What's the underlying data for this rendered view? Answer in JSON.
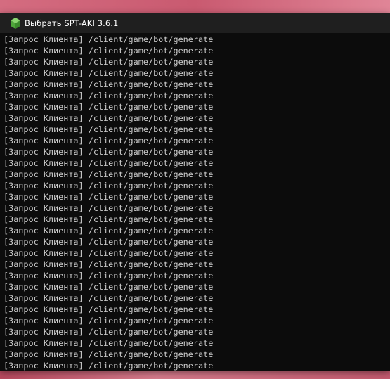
{
  "window": {
    "title": "Выбрать SPT-AKI 3.6.1",
    "icon": "green-cube-icon"
  },
  "console": {
    "lines": [
      "[Запрос Клиента] /client/game/bot/generate",
      "[Запрос Клиента] /client/game/bot/generate",
      "[Запрос Клиента] /client/game/bot/generate",
      "[Запрос Клиента] /client/game/bot/generate",
      "[Запрос Клиента] /client/game/bot/generate",
      "[Запрос Клиента] /client/game/bot/generate",
      "[Запрос Клиента] /client/game/bot/generate",
      "[Запрос Клиента] /client/game/bot/generate",
      "[Запрос Клиента] /client/game/bot/generate",
      "[Запрос Клиента] /client/game/bot/generate",
      "[Запрос Клиента] /client/game/bot/generate",
      "[Запрос Клиента] /client/game/bot/generate",
      "[Запрос Клиента] /client/game/bot/generate",
      "[Запрос Клиента] /client/game/bot/generate",
      "[Запрос Клиента] /client/game/bot/generate",
      "[Запрос Клиента] /client/game/bot/generate",
      "[Запрос Клиента] /client/game/bot/generate",
      "[Запрос Клиента] /client/game/bot/generate",
      "[Запрос Клиента] /client/game/bot/generate",
      "[Запрос Клиента] /client/game/bot/generate",
      "[Запрос Клиента] /client/game/bot/generate",
      "[Запрос Клиента] /client/game/bot/generate",
      "[Запрос Клиента] /client/game/bot/generate",
      "[Запрос Клиента] /client/game/bot/generate",
      "[Запрос Клиента] /client/game/bot/generate",
      "[Запрос Клиента] /client/game/bot/generate",
      "[Запрос Клиента] /client/game/bot/generate",
      "[Запрос Клиента] /client/game/bot/generate",
      "[Запрос Клиента] /client/game/bot/generate",
      "[Запрос Клиента] /client/game/bot/generate"
    ]
  },
  "colors": {
    "console_bg": "#0c0c0c",
    "titlebar_bg": "#1f1f1f",
    "console_text": "#cccccc",
    "icon_green": "#5cb85c"
  }
}
